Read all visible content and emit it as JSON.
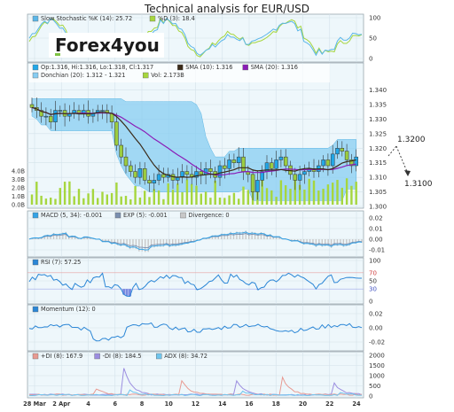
{
  "title": "Technical analysis for EUR/USD",
  "logo_text": "Forex4you",
  "annotations": {
    "upper": "1.3200",
    "lower": "1.3100"
  },
  "x_labels": [
    "28 Mar",
    "2 Apr",
    "4",
    "6",
    "8",
    "10",
    "12",
    "14",
    "16",
    "18",
    "20",
    "22",
    "24"
  ],
  "colors": {
    "panel_bg": "#eef7fb",
    "donchian_fill": "#87cdf2",
    "candle_up": "#22a7e8",
    "candle_down": "#9ccd40",
    "sma10": "#3a2a18",
    "sma20": "#8a1cb7",
    "volume": "#a6d63e",
    "macd": "#35a3e6",
    "signal": "#7a8fb0",
    "divergence": "#c8c8c8",
    "rsi": "#2b86d6",
    "momentum": "#2b86d6",
    "pdi": "#e89a92",
    "mdi": "#9b8de0",
    "adx": "#6fc5ee",
    "stoch_k": "#5ab6e8",
    "stoch_d": "#a6d63e"
  },
  "panels": {
    "stochastic": {
      "legend": [
        {
          "label": "Slow Stochastic %K (14): 25.72",
          "color": "#5ab6e8"
        },
        {
          "label": "%D (3): 18.4",
          "color": "#a6d63e"
        }
      ],
      "ticks": [
        "100",
        "50",
        "0"
      ]
    },
    "price": {
      "legend": [
        {
          "label": "Op:1.316, Hi:1.316, Lo:1.318, Cl:1.317",
          "color": "#22a7e8"
        },
        {
          "label": "SMA (10): 1.316",
          "color": "#3a2a18"
        },
        {
          "label": "SMA (20): 1.316",
          "color": "#8a1cb7"
        },
        {
          "label": "Donchian (20): 1.312 - 1.321",
          "color": "#87cdf2"
        },
        {
          "label": "Vol: 2.173B",
          "color": "#a6d63e"
        }
      ],
      "ticks": [
        "1.340",
        "1.335",
        "1.330",
        "1.325",
        "1.320",
        "1.315",
        "1.310",
        "1.305",
        "1.300"
      ],
      "volume_ticks": [
        "4.0B",
        "3.0B",
        "2.0B",
        "1.0B",
        "0.0B"
      ]
    },
    "macd": {
      "legend": [
        {
          "label": "MACD (5, 34): -0.001",
          "color": "#35a3e6"
        },
        {
          "label": "EXP (5): -0.001",
          "color": "#7a8fb0"
        },
        {
          "label": "Divergence: 0",
          "color": "#c8c8c8"
        }
      ],
      "ticks": [
        "0.02",
        "0.01",
        "0.00",
        "-0.01"
      ]
    },
    "rsi": {
      "legend": [
        {
          "label": "RSI (7): 57.25",
          "color": "#2b86d6"
        }
      ],
      "ticks": [
        "100",
        "70",
        "50",
        "30",
        "0"
      ]
    },
    "momentum": {
      "legend": [
        {
          "label": "Momentum (12): 0",
          "color": "#2b86d6"
        }
      ],
      "ticks": [
        "0.02",
        "0.00",
        "-0.02"
      ]
    },
    "adx": {
      "legend": [
        {
          "label": "+DI (8): 167.9",
          "color": "#e89a92"
        },
        {
          "label": "-DI (8): 184.5",
          "color": "#9b8de0"
        },
        {
          "label": "ADX (8): 34.72",
          "color": "#6fc5ee"
        }
      ],
      "ticks": [
        "2000",
        "1500",
        "1000",
        "500",
        "0"
      ]
    }
  },
  "chart_data": {
    "type": "candlestick",
    "title": "Technical analysis for EUR/USD",
    "x": [
      "28 Mar",
      "2 Apr",
      "4",
      "6",
      "8",
      "10",
      "12",
      "14",
      "16",
      "18",
      "20",
      "22",
      "24"
    ],
    "close": [
      1.334,
      1.333,
      1.331,
      1.331,
      1.329,
      1.333,
      1.333,
      1.331,
      1.332,
      1.333,
      1.332,
      1.333,
      1.331,
      1.332,
      1.333,
      1.333,
      1.332,
      1.329,
      1.321,
      1.317,
      1.314,
      1.312,
      1.31,
      1.313,
      1.309,
      1.308,
      1.309,
      1.311,
      1.31,
      1.311,
      1.309,
      1.31,
      1.312,
      1.311,
      1.31,
      1.312,
      1.311,
      1.313,
      1.312,
      1.31,
      1.314,
      1.313,
      1.316,
      1.315,
      1.317,
      1.312,
      1.311,
      1.305,
      1.309,
      1.312,
      1.315,
      1.313,
      1.316,
      1.317,
      1.314,
      1.311,
      1.309,
      1.311,
      1.312,
      1.313,
      1.312,
      1.314,
      1.316,
      1.314,
      1.318,
      1.32,
      1.319,
      1.316,
      1.314,
      1.317
    ],
    "ylim": [
      1.3,
      1.342
    ],
    "series_latest": {
      "sma10": 1.316,
      "sma20": 1.316,
      "donchian_low": 1.312,
      "donchian_high": 1.321,
      "volume": "2.173B"
    },
    "indicators": {
      "stochastic": {
        "k": 25.72,
        "d": 18.4,
        "ylim": [
          0,
          100
        ]
      },
      "macd": {
        "macd": -0.001,
        "exp": -0.001,
        "divergence": 0,
        "ylim": [
          -0.015,
          0.025
        ]
      },
      "rsi": {
        "value": 57.25,
        "levels": [
          30,
          70
        ],
        "ylim": [
          0,
          100
        ]
      },
      "momentum": {
        "value": 0,
        "ylim": [
          -0.03,
          0.03
        ]
      },
      "adx": {
        "pdi": 167.9,
        "mdi": 184.5,
        "adx": 34.72,
        "ylim": [
          0,
          2000
        ]
      }
    }
  }
}
